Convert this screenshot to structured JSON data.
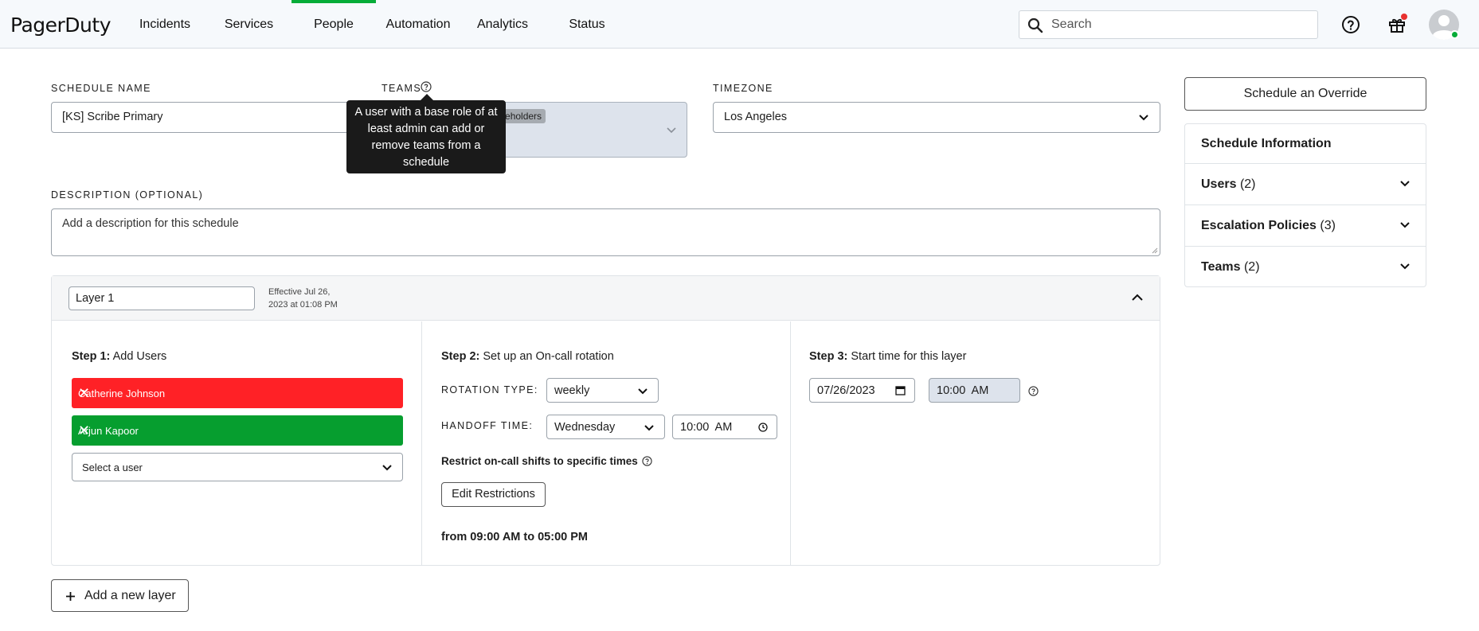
{
  "nav": {
    "logo": "PagerDuty",
    "items": [
      "Incidents",
      "Services",
      "People",
      "Automation",
      "Analytics",
      "Status"
    ],
    "active": "People",
    "search_placeholder": "Search",
    "gift_badge_color": "#e8312f",
    "status_dot_color": "#06ac38"
  },
  "form": {
    "schedule_name_label": "SCHEDULE NAME",
    "schedule_name_value": "[KS] Scribe Primary",
    "teams_label": "TEAMS",
    "teams_chip": "tive Stakeholders",
    "tooltip": "A user with a base role of at least admin can add or remove teams from a schedule",
    "timezone_label": "TIMEZONE",
    "timezone_value": "Los Angeles",
    "description_label": "DESCRIPTION (OPTIONAL)",
    "description_placeholder": "Add a description for this schedule"
  },
  "layer": {
    "name": "Layer 1",
    "effective_line1": "Effective Jul 26,",
    "effective_line2": "2023 at 01:08 PM",
    "step1_bold": "Step 1:",
    "step1_text": "Add Users",
    "users": [
      {
        "name": "Catherine Johnson",
        "color": "#ff2126"
      },
      {
        "name": "Arjun Kapoor",
        "color": "#069e2f"
      }
    ],
    "select_user": "Select a user",
    "step2_bold": "Step 2:",
    "step2_text": "Set up an On-call rotation",
    "rotation_type_label": "ROTATION TYPE:",
    "rotation_type_value": "weekly",
    "handoff_label": "HANDOFF TIME:",
    "handoff_day": "Wednesday",
    "handoff_time": "10:00  AM",
    "restrict_label": "Restrict on-call shifts to specific times",
    "edit_restrictions": "Edit Restrictions",
    "restriction_range": "from 09:00 AM to 05:00 PM",
    "step3_bold": "Step 3:",
    "step3_text": "Start time for this layer",
    "start_date": "07/26/2023",
    "start_time": "10:00  AM"
  },
  "add_layer": "Add a new layer",
  "sidebar": {
    "override_button": "Schedule an Override",
    "info_title": "Schedule Information",
    "rows": [
      {
        "label": "Users",
        "count": "(2)"
      },
      {
        "label": "Escalation Policies",
        "count": "(3)"
      },
      {
        "label": "Teams",
        "count": "(2)"
      }
    ]
  }
}
